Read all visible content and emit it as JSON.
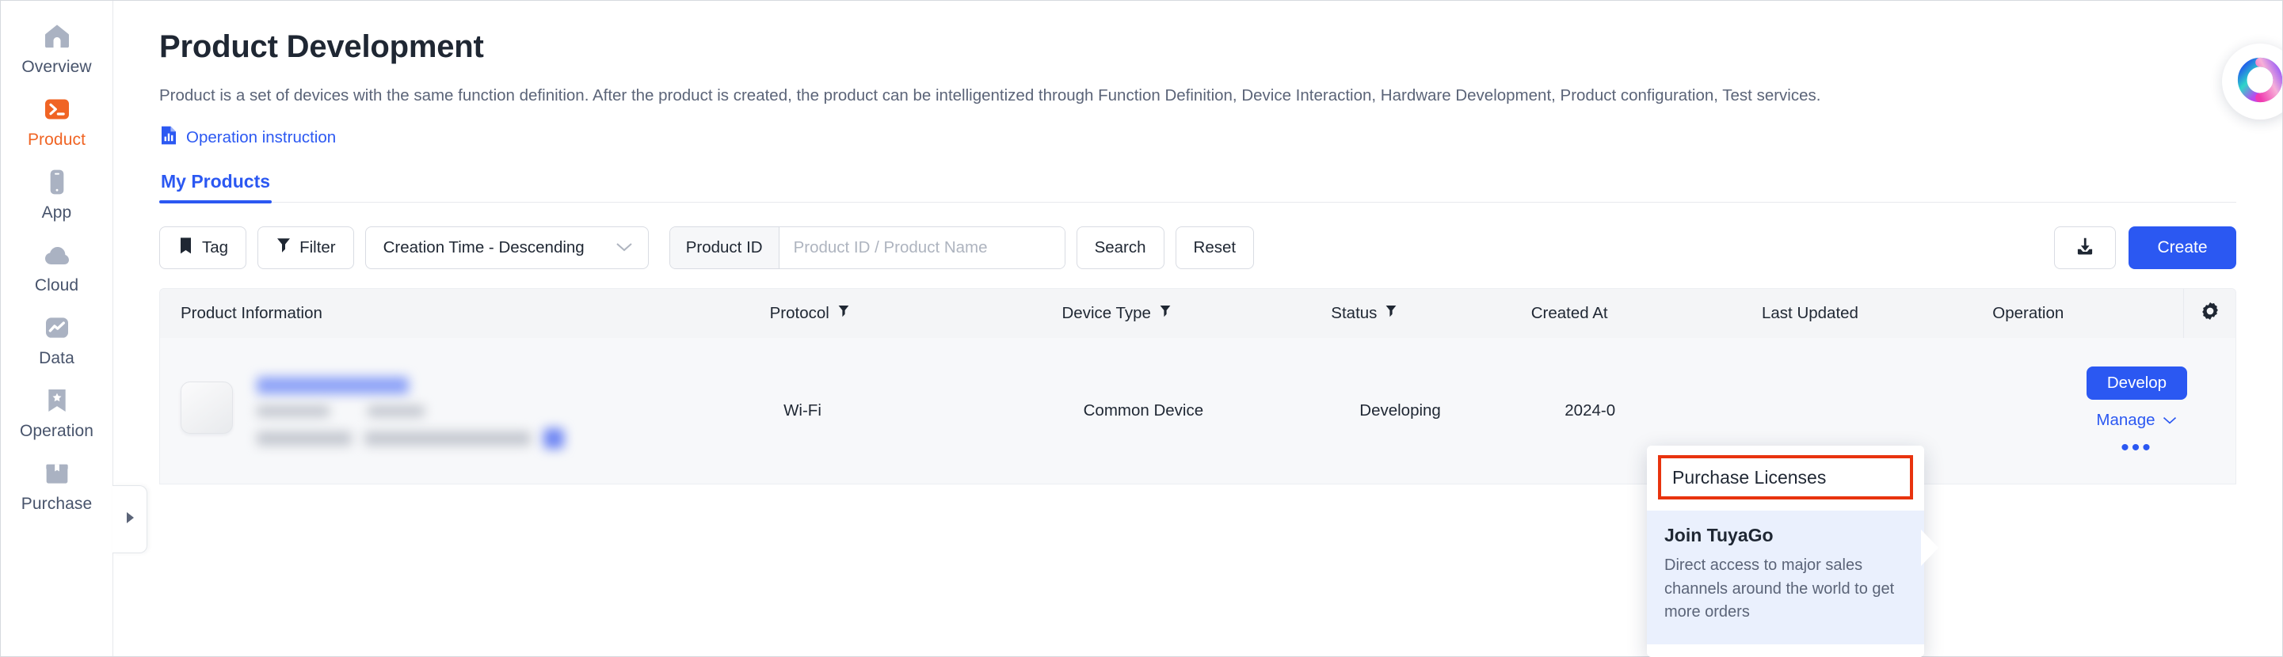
{
  "sidebar": {
    "items": [
      {
        "label": "Overview",
        "icon": "home-icon",
        "active": false
      },
      {
        "label": "Product",
        "icon": "terminal-icon",
        "active": true
      },
      {
        "label": "App",
        "icon": "phone-icon",
        "active": false
      },
      {
        "label": "Cloud",
        "icon": "cloud-icon",
        "active": false
      },
      {
        "label": "Data",
        "icon": "chart-icon",
        "active": false
      },
      {
        "label": "Operation",
        "icon": "bookmark-star-icon",
        "active": false
      },
      {
        "label": "Purchase",
        "icon": "box-icon",
        "active": false
      }
    ],
    "collapse_handle_icon": "triangle-right-icon"
  },
  "page": {
    "title": "Product Development",
    "description": "Product is a set of devices with the same function definition. After the product is created, the product can be intelligentized through Function Definition, Device Interaction, Hardware Development, Product configuration, Test services.",
    "operation_instruction": "Operation instruction",
    "operation_instruction_icon": "document-chart-icon"
  },
  "tabs": [
    {
      "label": "My Products",
      "active": true
    }
  ],
  "toolbar": {
    "tag_label": "Tag",
    "tag_icon": "bookmark-icon",
    "filter_label": "Filter",
    "filter_icon": "funnel-icon",
    "sort_label": "Creation Time - Descending",
    "sort_icon": "chevron-down-icon",
    "search_prefix": "Product ID",
    "search_placeholder": "Product ID / Product Name",
    "search_value": "",
    "search_button": "Search",
    "reset_button": "Reset",
    "download_icon": "download-icon",
    "create_button": "Create"
  },
  "table": {
    "columns": [
      {
        "label": "Product Information",
        "filter": false
      },
      {
        "label": "Protocol",
        "filter": true
      },
      {
        "label": "Device Type",
        "filter": true
      },
      {
        "label": "Status",
        "filter": true
      },
      {
        "label": "Created At",
        "filter": false
      },
      {
        "label": "Last Updated",
        "filter": false
      },
      {
        "label": "Operation",
        "filter": false
      }
    ],
    "settings_icon": "gear-icon",
    "rows": [
      {
        "product_information": "",
        "protocol": "Wi-Fi",
        "device_type": "Common Device",
        "status": "Developing",
        "created_at": "2024-0",
        "last_updated": "",
        "operation": {
          "develop_label": "Develop",
          "manage_label": "Manage",
          "manage_icon": "chevron-down-icon",
          "more_icon": "ellipsis-icon"
        }
      }
    ]
  },
  "popup": {
    "header_label": "Purchase Licenses",
    "highlight_color": "#e8330e",
    "item_title": "Join TuyaGo",
    "item_desc": "Direct access to major sales channels around the world to get more orders"
  },
  "ai_assistant": {
    "icon": "ai-swirl-icon"
  },
  "colors": {
    "accent_blue": "#2b58f2",
    "brand_orange": "#f06424",
    "highlight_red": "#e8330e"
  }
}
